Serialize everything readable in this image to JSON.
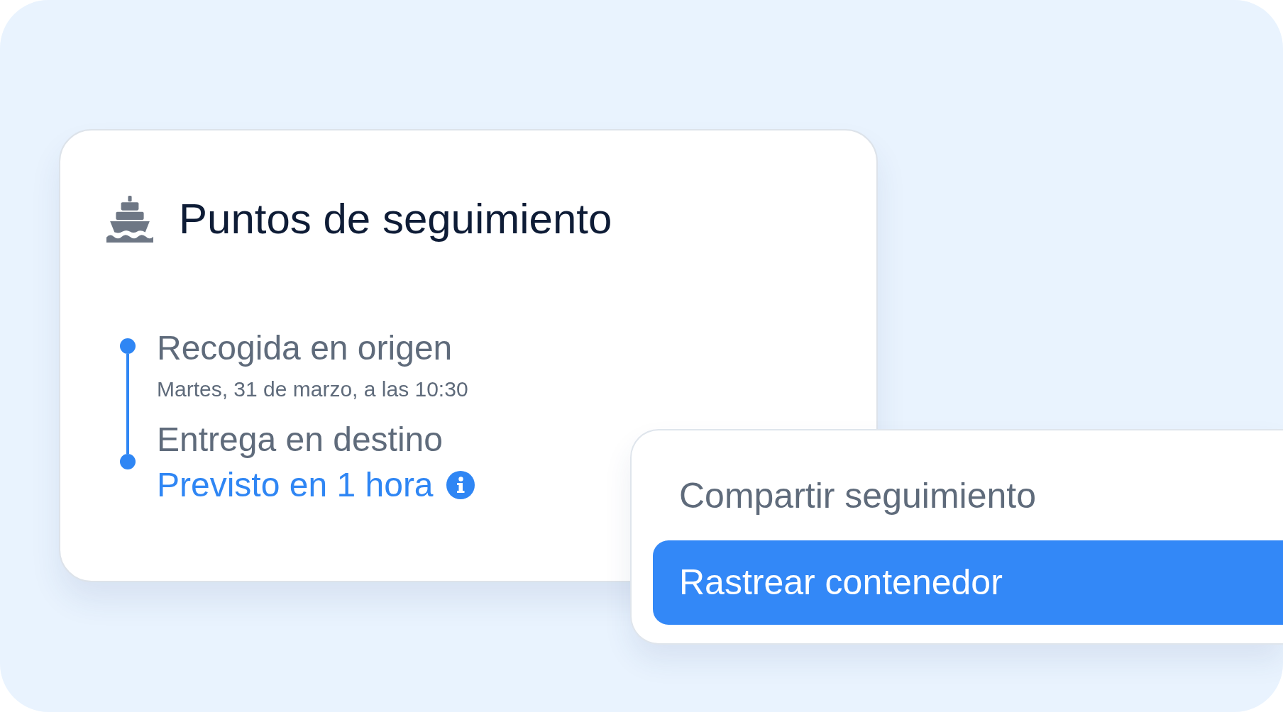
{
  "card": {
    "title": "Puntos de seguimiento",
    "events": [
      {
        "kind": "completed",
        "title": "Recogida en origen",
        "detail": "Martes, 31 de marzo, a las 10:30"
      },
      {
        "kind": "expected",
        "title": "Entrega en destino",
        "detail": "Previsto en 1 hora"
      }
    ]
  },
  "menu": {
    "items": [
      {
        "label": "Compartir seguimiento",
        "selected": false
      },
      {
        "label": "Rastrear contenedor",
        "selected": true
      }
    ]
  }
}
